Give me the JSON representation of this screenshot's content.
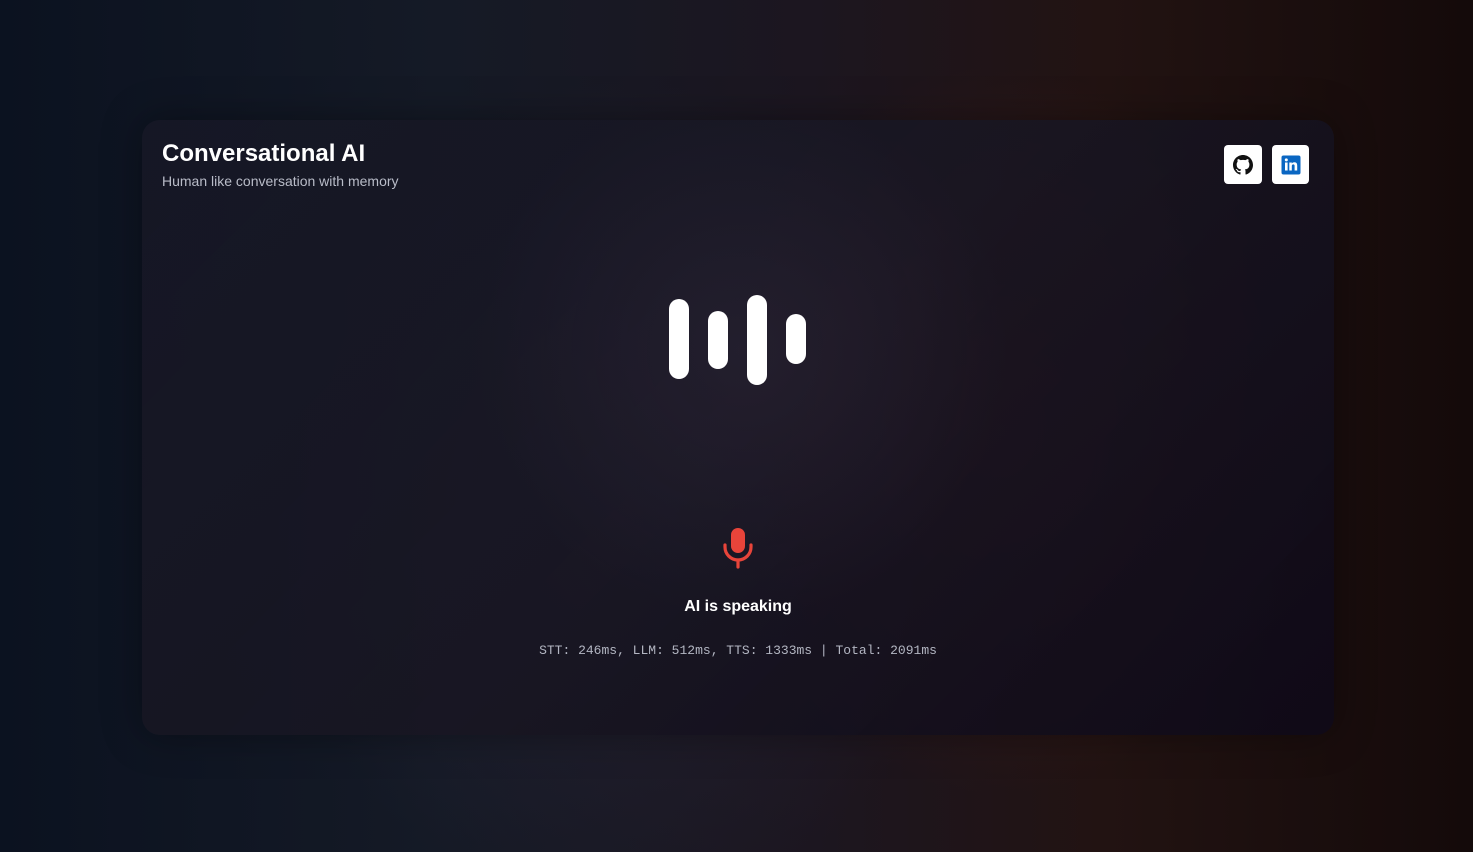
{
  "header": {
    "title": "Conversational AI",
    "subtitle": "Human like conversation with memory"
  },
  "social": [
    {
      "name": "GitHub",
      "icon": "github-icon"
    },
    {
      "name": "LinkedIn",
      "icon": "linkedin-icon"
    }
  ],
  "visualizer": {
    "icon": "audio-wave-icon",
    "color": "#ffffff"
  },
  "mic": {
    "icon": "microphone-icon",
    "color": "#e8443a"
  },
  "status": {
    "text": "AI is speaking"
  },
  "timings": {
    "text": "STT: 246ms, LLM: 512ms, TTS: 1333ms | Total: 2091ms"
  },
  "colors": {
    "linkedin_brand": "#0a66c2",
    "github_brand": "#111111",
    "accent_red": "#e8443a"
  }
}
